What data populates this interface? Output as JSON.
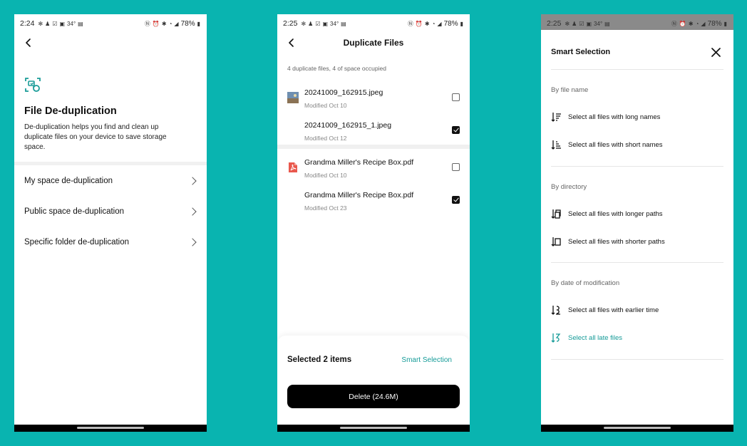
{
  "colors": {
    "background": "#09B4B0",
    "accent": "#159b98",
    "primary_button": "#000000"
  },
  "screen1": {
    "status": {
      "time": "2:24",
      "temp": "34°",
      "battery": "78%"
    },
    "icon": "dedup-scan-icon",
    "title": "File De-duplication",
    "description": "De-duplication helps you find and clean up duplicate files on your device to save storage space.",
    "menu": [
      {
        "label": "My space de-duplication"
      },
      {
        "label": "Public space de-duplication"
      },
      {
        "label": "Specific folder de-duplication"
      }
    ]
  },
  "screen2": {
    "status": {
      "time": "2:25",
      "temp": "34°",
      "battery": "78%"
    },
    "title": "Duplicate Files",
    "summary": "4 duplicate files, 4 of space occupied",
    "files": [
      {
        "name": "20241009_162915.jpeg",
        "modified": "Modified Oct 10",
        "checked": false,
        "icon": "image-thumbnail"
      },
      {
        "name": "20241009_162915_1.jpeg",
        "modified": "Modified Oct 12",
        "checked": true,
        "icon": "none"
      },
      {
        "name": "Grandma Miller's Recipe Box.pdf",
        "modified": "Modified Oct 10",
        "checked": false,
        "icon": "pdf-icon"
      },
      {
        "name": "Grandma Miller's Recipe Box.pdf",
        "modified": "Modified Oct 23",
        "checked": true,
        "icon": "none"
      }
    ],
    "selected_label": "Selected 2 items",
    "smart_link": "Smart Selection",
    "delete_label": "Delete (24.6M)"
  },
  "screen3": {
    "status": {
      "time": "2:25",
      "temp": "34°",
      "battery": "78%"
    },
    "title": "Smart Selection",
    "sections": [
      {
        "label": "By file name",
        "options": [
          {
            "label": "Select all files with long names",
            "active": false
          },
          {
            "label": "Select all files with short names",
            "active": false
          }
        ]
      },
      {
        "label": "By directory",
        "options": [
          {
            "label": "Select all files with longer paths",
            "active": false
          },
          {
            "label": "Select all files with shorter paths",
            "active": false
          }
        ]
      },
      {
        "label": "By date of modification",
        "options": [
          {
            "label": "Select all files with earlier time",
            "active": false
          },
          {
            "label": "Select all late files",
            "active": true
          }
        ]
      }
    ]
  }
}
